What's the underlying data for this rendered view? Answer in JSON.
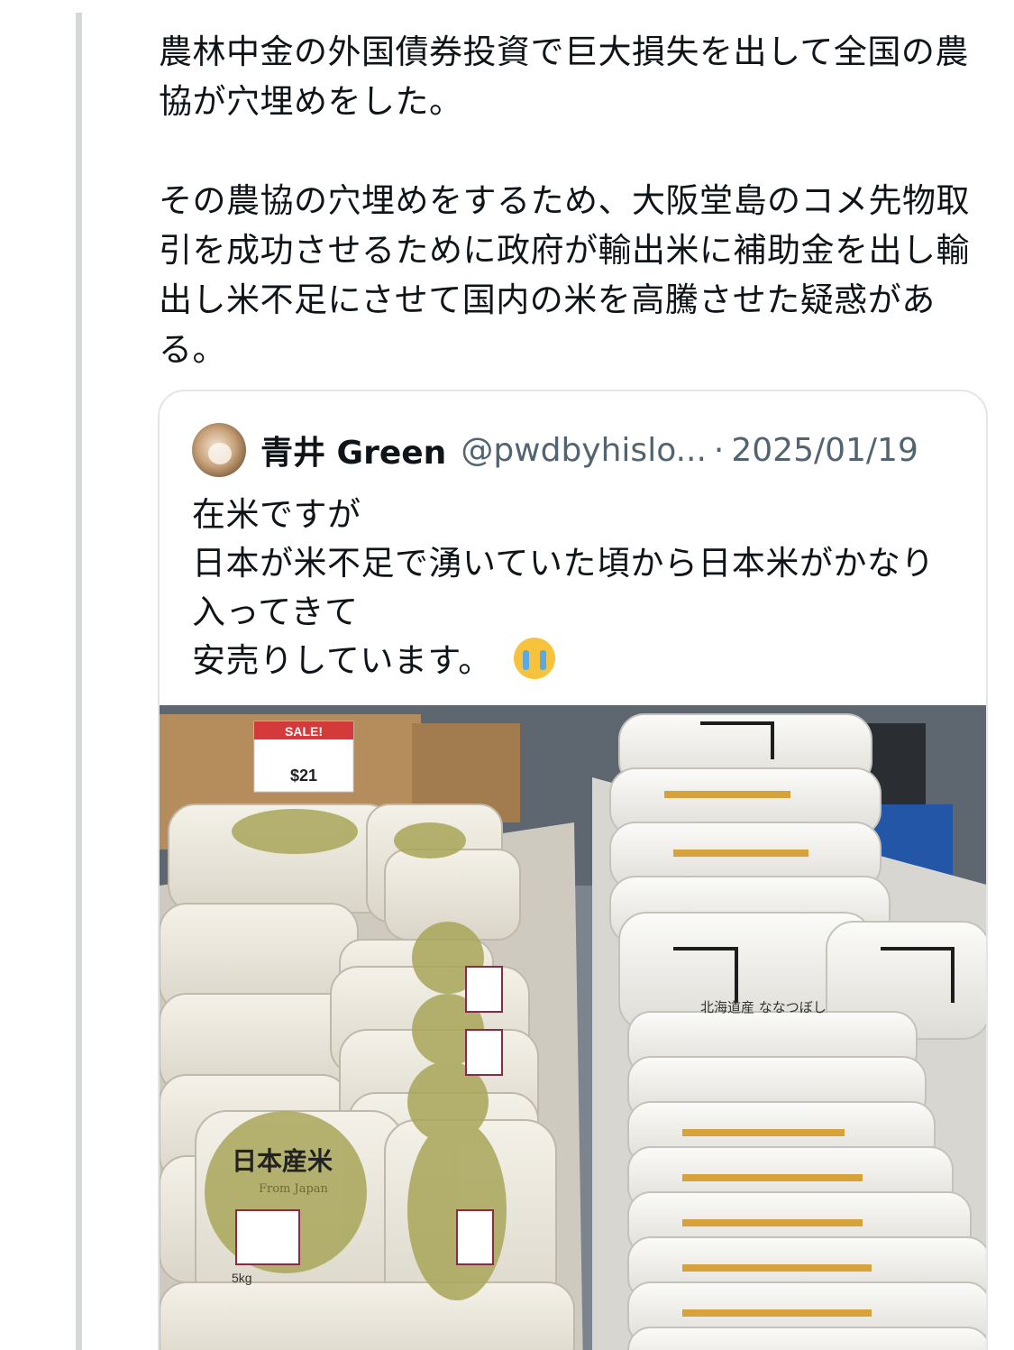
{
  "tweet": {
    "text": "農林中金の外国債券投資で巨大損失を出して全国の農協が穴埋めをした。\n\nその農協の穴埋めをするため、大阪堂島のコメ先物取引を成功させるために政府が輸出米に補助金を出し輸出し米不足にさせて国内の米を高騰させた疑惑がある。"
  },
  "quote": {
    "name": "青井 Green",
    "handle": "@pwdbyhislo...",
    "separator": "·",
    "date": "2025/01/19",
    "text": "在米ですが\n日本が米不足で湧いていた頃から日本米がかなり入ってきて\n安売りしています。",
    "emoji": "loudly-crying-face-emoji"
  },
  "photo": {
    "sale_sign": "SALE!",
    "sale_price": "$21",
    "bag_label_left": "日本産米",
    "bag_label_left_sub": "From Japan",
    "bag_weight": "5kg",
    "bag_label_right": "北海道産 ななつぼし"
  },
  "colors": {
    "thread_line": "#d5d7d9",
    "secondary_text": "#536471",
    "card_border": "#e3e6e8"
  }
}
